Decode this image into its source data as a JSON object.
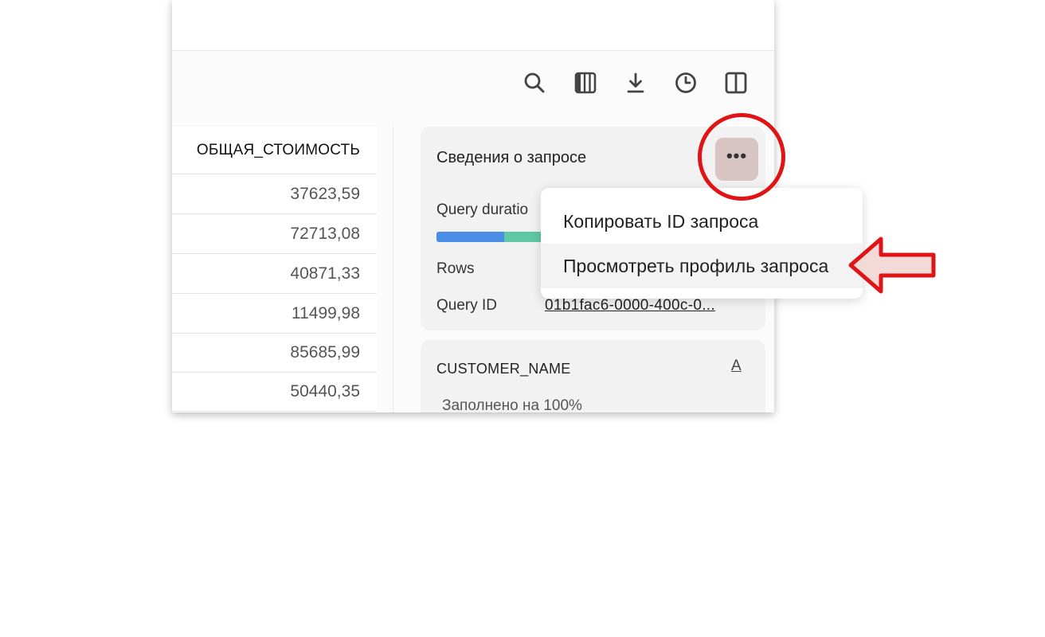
{
  "toolbar": {
    "icons": [
      "search-icon",
      "columns-icon",
      "download-icon",
      "history-icon",
      "split-view-icon"
    ]
  },
  "grid": {
    "column_header": "ОБЩАЯ_СТОИМОСТЬ",
    "rows": [
      "37623,59",
      "72713,08",
      "40871,33",
      "11499,98",
      "85685,99",
      "50440,35"
    ]
  },
  "query_details": {
    "title": "Сведения о запросе",
    "more_label": "•••",
    "duration_label": "Query duratio",
    "rows_label": "Rows",
    "query_id_label": "Query ID",
    "query_id_value": "01b1fac6-0000-400c-0..."
  },
  "column_card": {
    "name": "CUSTOMER_NAME",
    "type_icon": "A",
    "fill_text": "Заполнено на 100%"
  },
  "menu": {
    "items": [
      "Копировать ID запроса",
      "Просмотреть профиль запроса"
    ]
  },
  "colors": {
    "duration_blue": "#4a8de6",
    "duration_green": "#5fc8a5",
    "highlight_red": "#e01414"
  }
}
